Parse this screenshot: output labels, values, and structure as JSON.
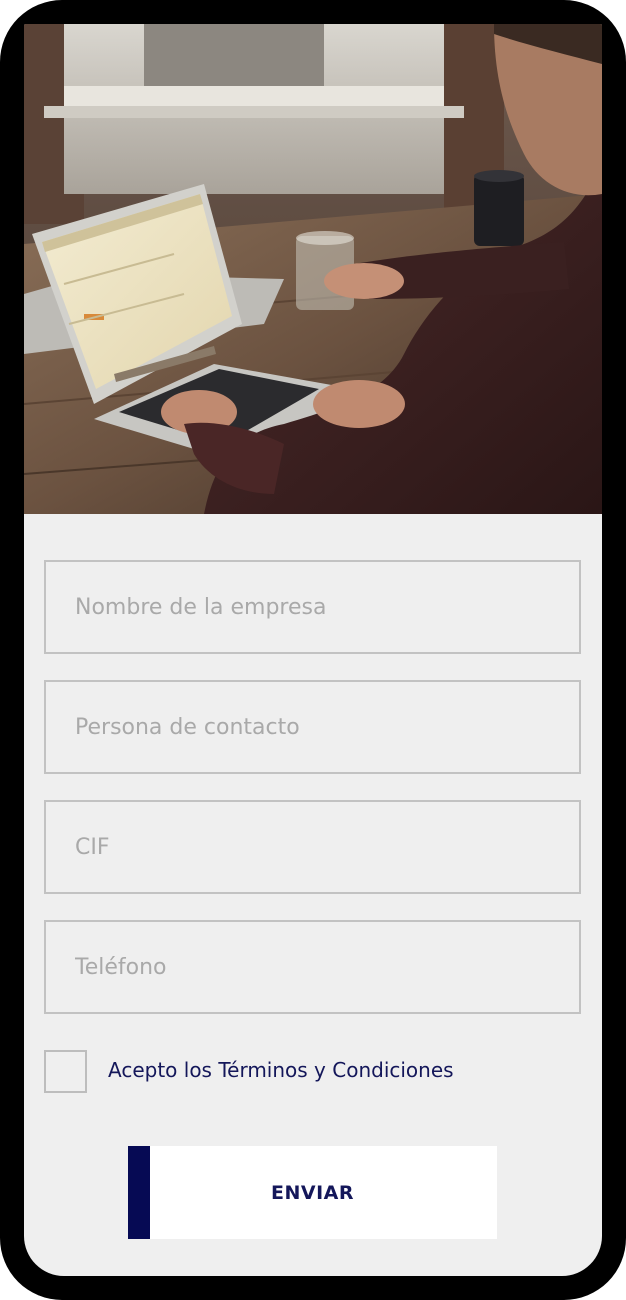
{
  "form": {
    "company_name_placeholder": "Nombre de la empresa",
    "contact_person_placeholder": "Persona de contacto",
    "cif_placeholder": "CIF",
    "phone_placeholder": "Teléfono",
    "terms_label": "Acepto los Términos y Condiciones",
    "terms_checked": false,
    "submit_label": "ENVIAR"
  },
  "colors": {
    "accent": "#060a54",
    "text_dark": "#14175a",
    "background": "#efefef",
    "field_border": "#c2c2c2"
  }
}
